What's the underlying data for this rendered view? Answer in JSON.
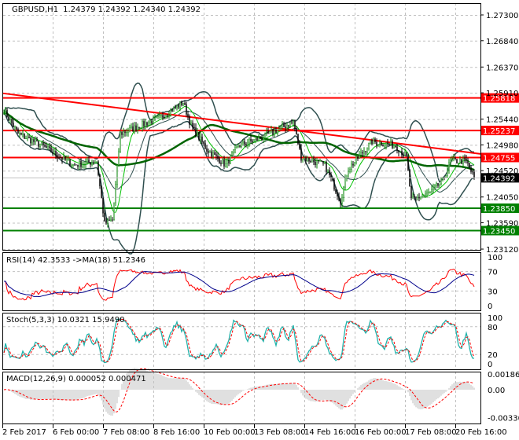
{
  "symbol_header": {
    "title": "GBPUSD,H1",
    "ohlc": "1.24379 1.24392 1.24340 1.24392"
  },
  "price_axis": {
    "ticks": [
      "1.27300",
      "1.26840",
      "1.26370",
      "1.25910",
      "1.25440",
      "1.24980",
      "1.24520",
      "1.24050",
      "1.23590",
      "1.23120"
    ],
    "tick_values": [
      1.273,
      1.2684,
      1.2637,
      1.2591,
      1.2544,
      1.2498,
      1.2452,
      1.2405,
      1.2359,
      1.2312
    ]
  },
  "levels": [
    {
      "value": 1.25818,
      "label": "1.25818",
      "color": "#ff0000"
    },
    {
      "value": 1.25237,
      "label": "1.25237",
      "color": "#ff0000"
    },
    {
      "value": 1.24755,
      "label": "1.24755",
      "color": "#ff0000"
    },
    {
      "value": 1.2385,
      "label": "1.23850",
      "color": "#008000"
    },
    {
      "value": 1.2345,
      "label": "1.23450",
      "color": "#008000"
    }
  ],
  "current_price": {
    "value": 1.24392,
    "label": "1.24392",
    "color": "#000000"
  },
  "price_keypoints": [
    [
      0,
      1.256
    ],
    [
      9,
      1.2518
    ],
    [
      24,
      1.2497
    ],
    [
      44,
      1.2462
    ],
    [
      59,
      1.2469
    ],
    [
      64,
      1.2357
    ],
    [
      69,
      1.2364
    ],
    [
      74,
      1.2518
    ],
    [
      86,
      1.2532
    ],
    [
      99,
      1.2546
    ],
    [
      114,
      1.2574
    ],
    [
      119,
      1.2532
    ],
    [
      129,
      1.249
    ],
    [
      141,
      1.2462
    ],
    [
      149,
      1.2497
    ],
    [
      164,
      1.2511
    ],
    [
      184,
      1.2539
    ],
    [
      189,
      1.2476
    ],
    [
      204,
      1.2462
    ],
    [
      214,
      1.2399
    ],
    [
      219,
      1.2455
    ],
    [
      234,
      1.2504
    ],
    [
      249,
      1.2497
    ],
    [
      256,
      1.2476
    ],
    [
      259,
      1.2399
    ],
    [
      271,
      1.2413
    ],
    [
      279,
      1.2434
    ],
    [
      284,
      1.2469
    ],
    [
      294,
      1.2469
    ],
    [
      299,
      1.2439
    ]
  ],
  "rsi": {
    "title": "RSI(14) 42.3533  ->MA(18) 51.2346",
    "ticks": [
      "100",
      "70",
      "30",
      "0"
    ]
  },
  "stoch": {
    "title": "Stoch(5,3,3) 10.0321 15.9490",
    "ticks": [
      "100",
      "80",
      "20",
      "0"
    ]
  },
  "macd": {
    "title": "MACD(12,26,9) 0.000052 0.000471",
    "ticks": [
      "0.001863",
      "0.00",
      "-0.003309"
    ]
  },
  "time_axis": [
    "2 Feb 2017",
    "6 Feb 00:00",
    "7 Feb 08:00",
    "8 Feb 16:00",
    "10 Feb 00:00",
    "13 Feb 08:00",
    "14 Feb 16:00",
    "16 Feb 00:00",
    "17 Feb 08:00",
    "20 Feb 16:00"
  ],
  "colors": {
    "bull": "#008000",
    "bear": "#000000",
    "bands": "#2f4f4f",
    "ma_slow": "#006400",
    "ma_fast": "#00c000",
    "trend": "#ff0000",
    "rsi": "#ff0000",
    "rsi_ma": "#00008b",
    "stoch_main": "#20b2aa",
    "stoch_signal": "#ff0000",
    "macd_hist": "#c0c0c0"
  }
}
